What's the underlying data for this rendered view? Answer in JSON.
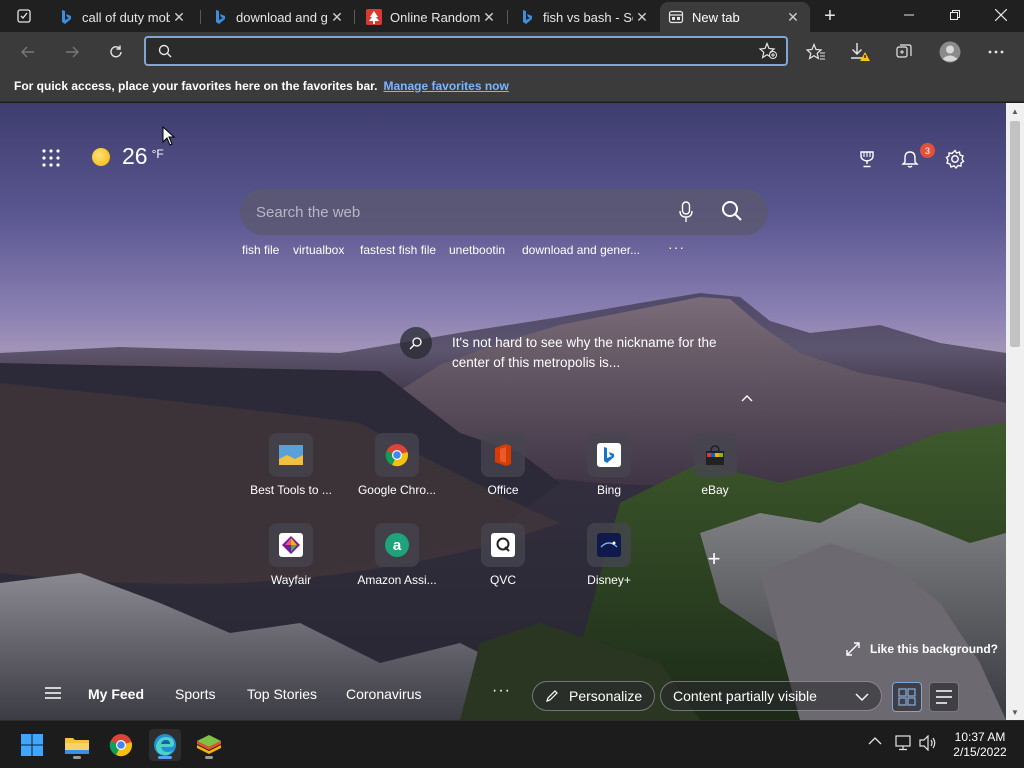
{
  "tabs": [
    {
      "title": "call of duty mob",
      "favicon": "bing-icon"
    },
    {
      "title": "download and g",
      "favicon": "bing-icon"
    },
    {
      "title": "Online Random",
      "favicon": "tree-icon"
    },
    {
      "title": "fish vs bash - Se",
      "favicon": "bing-icon"
    },
    {
      "title": "New tab",
      "favicon": "newtab-icon",
      "active": true
    }
  ],
  "address_bar": {
    "value": ""
  },
  "favorites_bar": {
    "message": "For quick access, place your favorites here on the favorites bar.",
    "link": "Manage favorites now"
  },
  "weather": {
    "temp": "26",
    "unit": "°F"
  },
  "notifications": {
    "count": "3"
  },
  "search": {
    "placeholder": "Search the web"
  },
  "suggestions": [
    "fish file",
    "virtualbox",
    "fastest fish file",
    "unetbootin",
    "download and gener...",
    "···"
  ],
  "trivia": {
    "text": "It's not hard to see why the nickname for the center of this metropolis is..."
  },
  "quick_links": [
    {
      "label": "Best Tools to ..."
    },
    {
      "label": "Google Chro..."
    },
    {
      "label": "Office"
    },
    {
      "label": "Bing"
    },
    {
      "label": "eBay"
    },
    {
      "label": "Wayfair"
    },
    {
      "label": "Amazon Assi..."
    },
    {
      "label": "QVC"
    },
    {
      "label": "Disney+"
    }
  ],
  "background": {
    "like_label": "Like this background?"
  },
  "feed": {
    "tabs": [
      "My Feed",
      "Sports",
      "Top Stories",
      "Coronavirus"
    ],
    "more": "···",
    "personalize": "Personalize",
    "content_visibility": "Content partially visible"
  },
  "clock": {
    "time": "10:37 AM",
    "date": "2/15/2022"
  },
  "colors": {
    "accent": "#7fa7d6",
    "link": "#7cb5ff",
    "badge": "#e0533a"
  }
}
